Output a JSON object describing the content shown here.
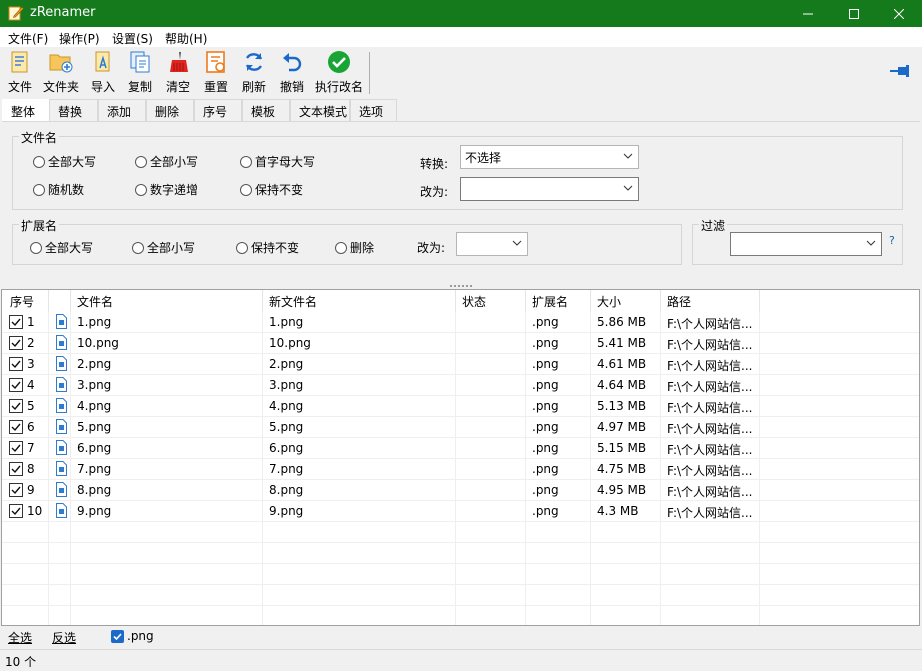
{
  "window": {
    "title": "zRenamer",
    "icon": "pencil-notepad-icon"
  },
  "menu": [
    {
      "label": "文件(F)"
    },
    {
      "label": "操作(P)"
    },
    {
      "label": "设置(S)"
    },
    {
      "label": "帮助(H)"
    }
  ],
  "toolbar": [
    {
      "label": "文件",
      "icon": "file-open-icon"
    },
    {
      "label": "文件夹",
      "icon": "folder-add-icon"
    },
    {
      "label": "导入",
      "icon": "import-icon"
    },
    {
      "label": "复制",
      "icon": "copy-icon"
    },
    {
      "label": "清空",
      "icon": "broom-icon"
    },
    {
      "label": "重置",
      "icon": "reset-icon"
    },
    {
      "label": "刷新",
      "icon": "refresh-icon"
    },
    {
      "label": "撤销",
      "icon": "undo-icon"
    },
    {
      "label": "执行改名",
      "icon": "check-execute-icon"
    }
  ],
  "tabs": [
    "整体",
    "替换",
    "添加",
    "删除",
    "序号",
    "模板",
    "文本模式",
    "选项"
  ],
  "filename_group": {
    "title": "文件名",
    "options": [
      "全部大写",
      "全部小写",
      "首字母大写",
      "随机数",
      "数字递增",
      "保持不变"
    ],
    "convert_label": "转换:",
    "convert_value": "不选择",
    "change_label": "改为:",
    "change_value": ""
  },
  "ext_group": {
    "title": "扩展名",
    "options": [
      "全部大写",
      "全部小写",
      "保持不变",
      "删除"
    ],
    "change_label": "改为:",
    "change_value": ""
  },
  "filter_group": {
    "title": "过滤",
    "value": "",
    "help": "?"
  },
  "table": {
    "columns": [
      "序号",
      "",
      "文件名",
      "新文件名",
      "状态",
      "扩展名",
      "大小",
      "路径"
    ],
    "rows": [
      {
        "n": "1",
        "name": "1.png",
        "newname": "1.png",
        "status": "",
        "ext": ".png",
        "size": "5.86 MB",
        "path": "F:\\个人网站信..."
      },
      {
        "n": "2",
        "name": "10.png",
        "newname": "10.png",
        "status": "",
        "ext": ".png",
        "size": "5.41 MB",
        "path": "F:\\个人网站信..."
      },
      {
        "n": "3",
        "name": "2.png",
        "newname": "2.png",
        "status": "",
        "ext": ".png",
        "size": "4.61 MB",
        "path": "F:\\个人网站信..."
      },
      {
        "n": "4",
        "name": "3.png",
        "newname": "3.png",
        "status": "",
        "ext": ".png",
        "size": "4.64 MB",
        "path": "F:\\个人网站信..."
      },
      {
        "n": "5",
        "name": "4.png",
        "newname": "4.png",
        "status": "",
        "ext": ".png",
        "size": "5.13 MB",
        "path": "F:\\个人网站信..."
      },
      {
        "n": "6",
        "name": "5.png",
        "newname": "5.png",
        "status": "",
        "ext": ".png",
        "size": "4.97 MB",
        "path": "F:\\个人网站信..."
      },
      {
        "n": "7",
        "name": "6.png",
        "newname": "6.png",
        "status": "",
        "ext": ".png",
        "size": "5.15 MB",
        "path": "F:\\个人网站信..."
      },
      {
        "n": "8",
        "name": "7.png",
        "newname": "7.png",
        "status": "",
        "ext": ".png",
        "size": "4.75 MB",
        "path": "F:\\个人网站信..."
      },
      {
        "n": "9",
        "name": "8.png",
        "newname": "8.png",
        "status": "",
        "ext": ".png",
        "size": "4.95 MB",
        "path": "F:\\个人网站信..."
      },
      {
        "n": "10",
        "name": "9.png",
        "newname": "9.png",
        "status": "",
        "ext": ".png",
        "size": "4.3 MB",
        "path": "F:\\个人网站信..."
      }
    ]
  },
  "bottom": {
    "select_all": "全选",
    "invert": "反选",
    "ext_filter": ".png"
  },
  "status": {
    "count": "10 个"
  },
  "colors": {
    "titlebar": "#157a1b",
    "accent": "#1b6ac9"
  }
}
